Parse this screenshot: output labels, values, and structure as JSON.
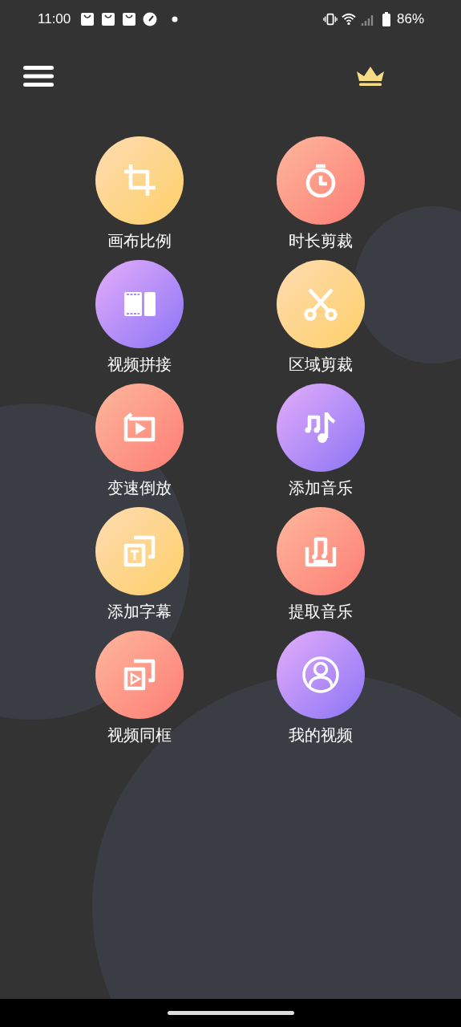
{
  "status_bar": {
    "time": "11:00",
    "battery": "86%"
  },
  "tools": [
    {
      "label": "画布比例",
      "kind": "crop"
    },
    {
      "label": "时长剪裁",
      "kind": "timer"
    },
    {
      "label": "视频拼接",
      "kind": "film"
    },
    {
      "label": "区域剪裁",
      "kind": "scissors"
    },
    {
      "label": "变速倒放",
      "kind": "replay"
    },
    {
      "label": "添加音乐",
      "kind": "music"
    },
    {
      "label": "添加字幕",
      "kind": "subtitle"
    },
    {
      "label": "提取音乐",
      "kind": "extract"
    },
    {
      "label": "视频同框",
      "kind": "frame"
    },
    {
      "label": "我的视频",
      "kind": "user"
    }
  ]
}
